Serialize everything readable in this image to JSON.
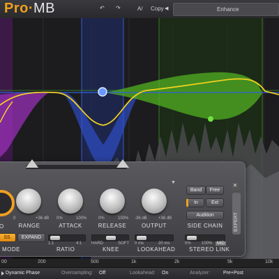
{
  "logo": {
    "pro": "Pro",
    "dot": "·",
    "mb": "MB"
  },
  "toolbar": {
    "undo_icon": "undo-icon",
    "redo_icon": "redo-icon",
    "ab_label": "A/",
    "copy_label": "Copy",
    "prev_icon": "◀",
    "preset_label": "Enhance"
  },
  "colors": {
    "accent": "#f0a020",
    "band_purple": "#a030c0",
    "band_blue": "#3050d0",
    "band_green": "#50b020",
    "curve": "#f0d020",
    "eq_line": "#3060e0"
  },
  "controls": {
    "knobs": [
      {
        "label": "RANGE",
        "min": "0",
        "max": "+36 dB"
      },
      {
        "label": "ATTACK",
        "min": "0%",
        "max": "100%"
      },
      {
        "label": "RELEASE",
        "min": "0%",
        "max": "100%"
      },
      {
        "label": "OUTPUT",
        "min": "-36 dB",
        "max": "+36 dB"
      }
    ],
    "partial_label": "O",
    "mode_buttons": {
      "compress": "SS",
      "expand": "EXPAND"
    },
    "mode_label": "MODE",
    "ratio": {
      "label": "RATIO",
      "min": "1:1",
      "max": "4:1"
    },
    "knee": {
      "label": "KNEE",
      "min": "HARD",
      "max": "SOFT"
    },
    "lookahead": {
      "label": "LOOKAHEAD",
      "min": "0 ms",
      "max": "20 ms"
    },
    "side_chain": {
      "band": "Band",
      "free": "Free",
      "in": "In",
      "ext": "Ext",
      "audition": "Audition",
      "label": "SIDE CHAIN"
    },
    "stereo_link": {
      "label": "STEREO LINK",
      "min": "0%",
      "max": "100%",
      "mid": "MID"
    },
    "expert_label": "EXPERT",
    "close_icon": "✕"
  },
  "freq_ticks": [
    "00",
    "200",
    "500",
    "1k",
    "2k",
    "5k",
    "10k"
  ],
  "status": {
    "phase_value": "Dynamic Phase",
    "oversampling_label": "Oversampling:",
    "oversampling_value": "Off",
    "lookahead_label": "Lookahead:",
    "lookahead_value": "On",
    "analyzer_label": "Analyzer:",
    "analyzer_value": "Pre+Post"
  }
}
